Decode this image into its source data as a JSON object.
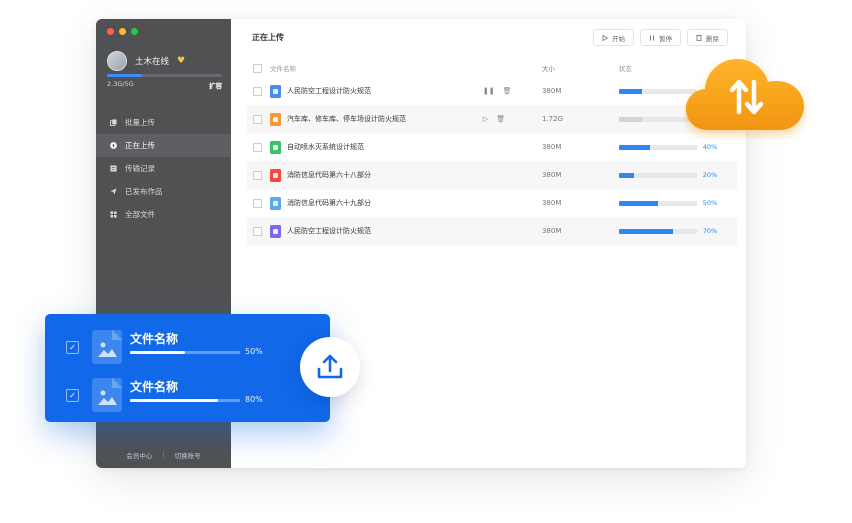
{
  "user": {
    "name": "土木在线",
    "storage_used": "2.3G/5G",
    "expand_label": "扩容",
    "storage_fraction": 0.3,
    "vip_glyph": "♥"
  },
  "nav": [
    {
      "label": "批量上传",
      "icon": "copy-icon"
    },
    {
      "label": "正在上传",
      "icon": "upload-circle-icon"
    },
    {
      "label": "传输记录",
      "icon": "document-icon"
    },
    {
      "label": "已发布作品",
      "icon": "send-icon"
    },
    {
      "label": "全部文件",
      "icon": "grid-icon"
    }
  ],
  "footer": {
    "member_center": "会员中心",
    "separator": "|",
    "switch_account": "切换账号"
  },
  "main": {
    "title": "正在上传",
    "toolbar": {
      "start": "开始",
      "pause": "暂停",
      "delete": "删除"
    },
    "columns": {
      "name": "文件名称",
      "size": "大小",
      "status": "状态"
    }
  },
  "files": [
    {
      "name": "人民防空工程设计防火规范",
      "size": "380M",
      "progress": 0.3,
      "pct": "30%",
      "icon_color": "#4a8cf0",
      "action": "pause"
    },
    {
      "name": "汽车库、修车库、停车场设计防火规范",
      "size": "1.72G",
      "progress": 0.3,
      "pct": "",
      "icon_color": "#f39a3a",
      "action": "play",
      "paused": true
    },
    {
      "name": "自动喷水灭系统设计规范",
      "size": "380M",
      "progress": 0.4,
      "pct": "40%",
      "icon_color": "#3cc26e"
    },
    {
      "name": "消防信息代码第六十八部分",
      "size": "380M",
      "progress": 0.2,
      "pct": "20%",
      "icon_color": "#ef4a4a"
    },
    {
      "name": "消防信息代码第六十九部分",
      "size": "380M",
      "progress": 0.5,
      "pct": "50%",
      "icon_color": "#5aa8ee"
    },
    {
      "name": "人民防空工程设计防火规范",
      "size": "380M",
      "progress": 0.7,
      "pct": "70%",
      "icon_color": "#7b6ae8"
    }
  ],
  "floating_card": {
    "items": [
      {
        "title": "文件名称",
        "progress": 0.5,
        "pct": "50%"
      },
      {
        "title": "文件名称",
        "progress": 0.8,
        "pct": "80%"
      }
    ]
  },
  "colors": {
    "accent": "#2f86f6",
    "sidebar": "#505153",
    "card": "#1168e8",
    "cloud": "#f7a31a"
  }
}
